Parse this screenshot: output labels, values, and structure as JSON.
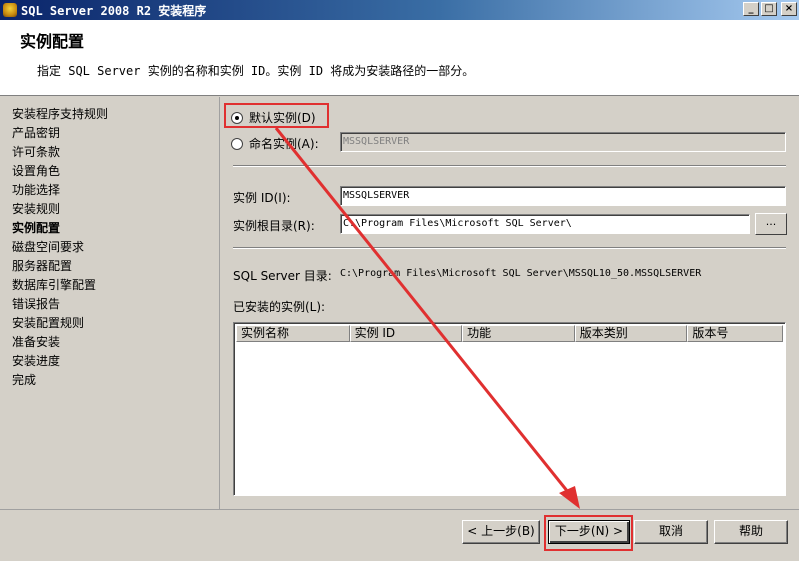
{
  "window": {
    "title": "SQL Server 2008 R2 安装程序",
    "minimize": "_",
    "maximize": "□",
    "close": "×"
  },
  "header": {
    "title": "实例配置",
    "subtitle": "指定 SQL Server 实例的名称和实例 ID。实例 ID 将成为安装路径的一部分。"
  },
  "sidebar": {
    "items": [
      {
        "label": "安装程序支持规则"
      },
      {
        "label": "产品密钥"
      },
      {
        "label": "许可条款"
      },
      {
        "label": "设置角色"
      },
      {
        "label": "功能选择"
      },
      {
        "label": "安装规则"
      },
      {
        "label": "实例配置"
      },
      {
        "label": "磁盘空间要求"
      },
      {
        "label": "服务器配置"
      },
      {
        "label": "数据库引擎配置"
      },
      {
        "label": "错误报告"
      },
      {
        "label": "安装配置规则"
      },
      {
        "label": "准备安装"
      },
      {
        "label": "安装进度"
      },
      {
        "label": "完成"
      }
    ]
  },
  "instance": {
    "default_label": "默认实例(D)",
    "named_label": "命名实例(A):",
    "named_value": "MSSQLSERVER",
    "id_label": "实例 ID(I):",
    "id_value": "MSSQLSERVER",
    "root_label": "实例根目录(R):",
    "root_value": "C:\\Program Files\\Microsoft SQL Server\\",
    "browse_label": "...",
    "dir_label": "SQL Server 目录:",
    "dir_value": "C:\\Program Files\\Microsoft SQL Server\\MSSQL10_50.MSSQLSERVER",
    "installed_label": "已安装的实例(L):"
  },
  "table": {
    "columns": [
      "实例名称",
      "实例 ID",
      "功能",
      "版本类别",
      "版本号"
    ]
  },
  "footer": {
    "back": "< 上一步(B)",
    "next": "下一步(N) >",
    "cancel": "取消",
    "help": "帮助"
  },
  "colors": {
    "annotation": "#e03030"
  }
}
